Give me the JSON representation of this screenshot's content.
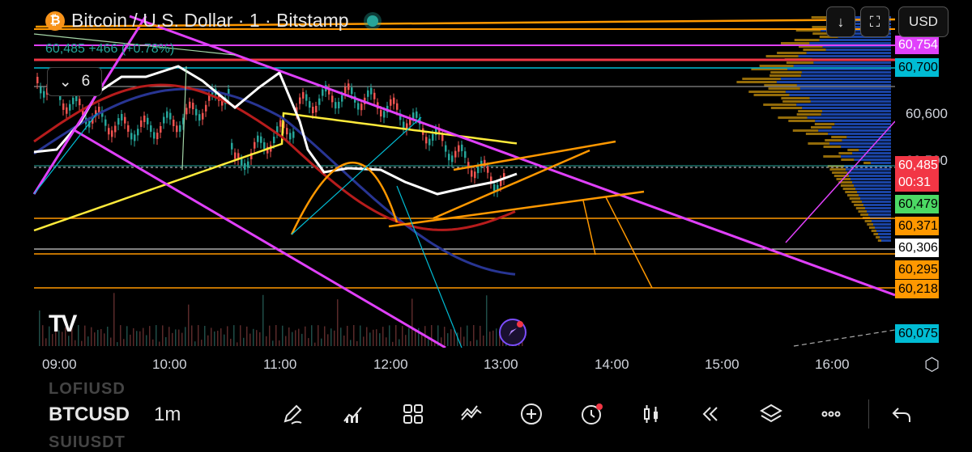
{
  "header": {
    "symbol_title": "Bitcoin / U.S. Dollar · 1 · Bitstamp",
    "icon": "bitcoin-icon",
    "ohlc_change": "60,485 +466 (+0.78%)",
    "indicators_count": "6",
    "currency": "USD"
  },
  "price_axis": {
    "labels": [
      {
        "text": "60,754",
        "bg": "#e040fb",
        "fg": "#ffffff",
        "kind": "tag"
      },
      {
        "text": "60,700",
        "bg": "#00bcd4",
        "fg": "#000000",
        "kind": "tag"
      },
      {
        "text": "60,600",
        "bg": "",
        "fg": "#d1d4dc",
        "kind": "plain"
      },
      {
        "text": "60,500",
        "bg": "",
        "fg": "#d1d4dc",
        "kind": "plain"
      },
      {
        "text": "60,485",
        "bg": "#f23645",
        "fg": "#ffffff",
        "kind": "tag"
      },
      {
        "text": "00:31",
        "bg": "#f23645",
        "fg": "#ffffff",
        "kind": "tag"
      },
      {
        "text": "60,479",
        "bg": "#4cd964",
        "fg": "#000000",
        "kind": "tag"
      },
      {
        "text": "60,371",
        "bg": "#ff9800",
        "fg": "#000000",
        "kind": "tag"
      },
      {
        "text": "60,306",
        "bg": "#ffffff",
        "fg": "#000000",
        "kind": "tag"
      },
      {
        "text": "60,295",
        "bg": "#ff9800",
        "fg": "#000000",
        "kind": "tag"
      },
      {
        "text": "60,218",
        "bg": "#ff9800",
        "fg": "#000000",
        "kind": "tag"
      },
      {
        "text": "60,075",
        "bg": "#00bcd4",
        "fg": "#000000",
        "kind": "tag"
      }
    ]
  },
  "time_axis": {
    "labels": [
      "09:00",
      "10:00",
      "11:00",
      "12:00",
      "13:00",
      "14:00",
      "15:00",
      "16:00"
    ]
  },
  "bottom_bar": {
    "ghost_above": "LOFIUSD",
    "symbol": "BTCUSD",
    "interval": "1m",
    "ghost_below": "SUIUSDT",
    "tools": [
      "pencil-icon",
      "indicators-icon",
      "grid-icon",
      "patterns-icon",
      "add-icon",
      "alert-clock-icon",
      "candles-icon",
      "replay-icon",
      "layers-icon",
      "more-icon",
      "undo-icon"
    ]
  },
  "colors": {
    "up": "#26a69a",
    "down": "#ef5350",
    "trendline": "#e040fb",
    "orange": "#ff9800",
    "cyan": "#00bcd4",
    "yellow": "#ffeb3b"
  }
}
